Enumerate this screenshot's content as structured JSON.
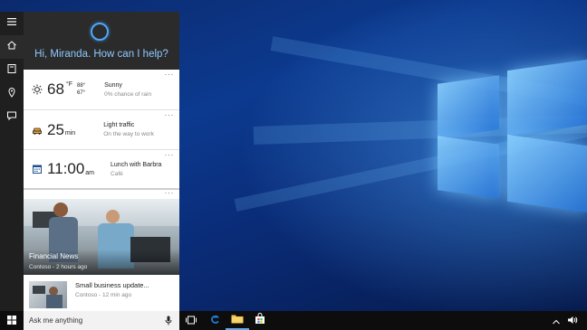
{
  "cortana": {
    "greeting": "Hi, Miranda. How can I help?"
  },
  "weather": {
    "temp": "68",
    "unit": "°F",
    "high": "88°",
    "low": "67°",
    "condition": "Sunny",
    "rain": "0% chance of rain",
    "more": "···"
  },
  "traffic": {
    "minutes": "25",
    "unit": "min",
    "status": "Light traffic",
    "detail": "On the way to work",
    "more": "···"
  },
  "calendar": {
    "time": "11:00",
    "ampm": "am",
    "event": "Lunch with Barbra",
    "location": "Café",
    "more": "···"
  },
  "news": {
    "more": "···",
    "headline_title": "Financial News",
    "headline_sub": "Contoso - 2 hours ago",
    "item_title": "Small business update...",
    "item_sub": "Contoso - 12 min ago"
  },
  "askbar": {
    "placeholder": "Ask me anything"
  },
  "icons": {
    "rail": [
      "hamburger-icon",
      "home-icon",
      "notebook-icon",
      "location-icon",
      "feedback-icon"
    ],
    "taskbar": [
      "windows-icon",
      "task-view-icon",
      "edge-icon",
      "file-explorer-icon",
      "store-icon"
    ],
    "tray": [
      "chevron-up-icon",
      "volume-icon"
    ]
  },
  "colors": {
    "accent": "#4aa8ff",
    "greeting": "#8fc8ff",
    "edge": "#1e7fe0",
    "folder": "#f3c44a"
  }
}
